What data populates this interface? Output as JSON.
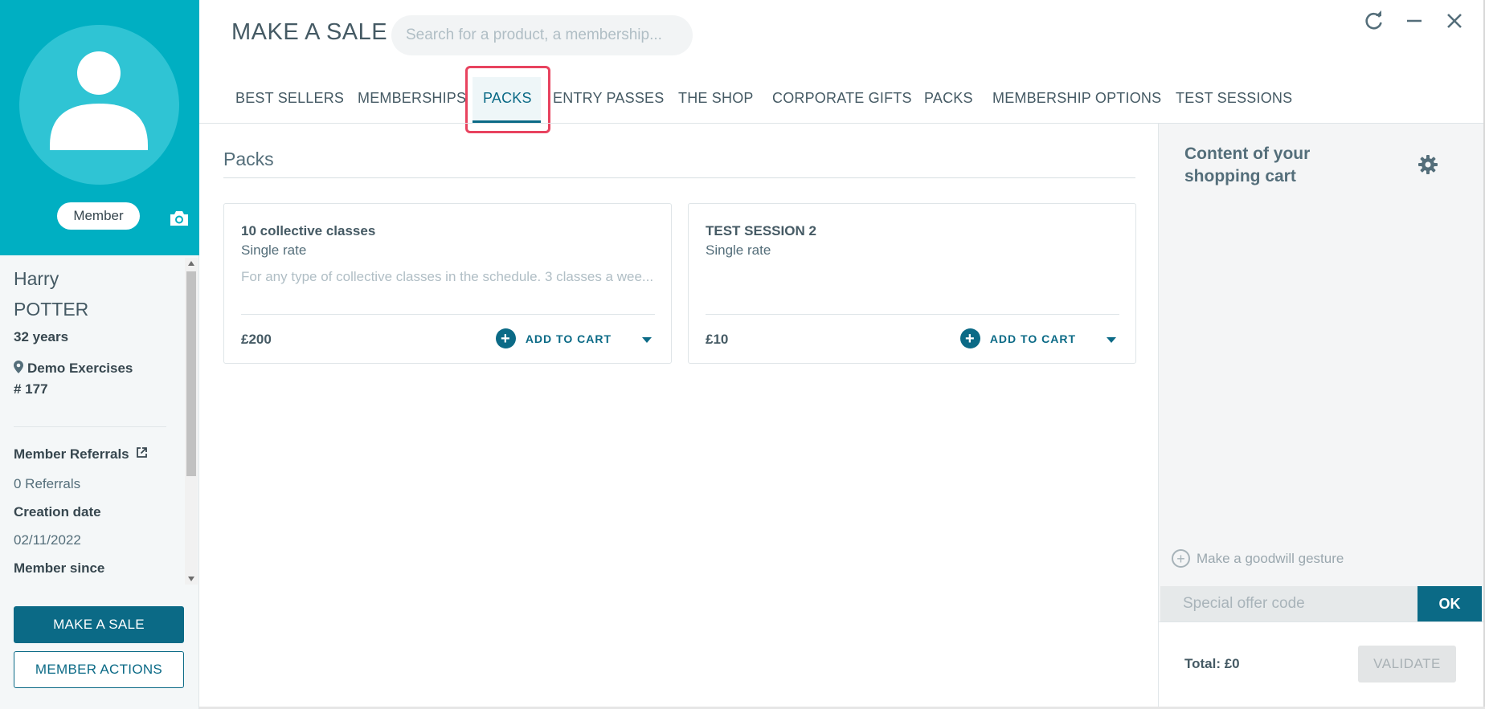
{
  "colors": {
    "brand_teal": "#00afc2",
    "primary": "#0b6a86",
    "highlight": "#e8435f",
    "text": "#455a64"
  },
  "member": {
    "badge": "Member",
    "first_name": "Harry",
    "last_name": "POTTER",
    "age": "32 years",
    "location": "Demo Exercises",
    "number": "# 177",
    "referrals_label": "Member Referrals",
    "referrals_value": "0 Referrals",
    "creation_label": "Creation date",
    "creation_value": "02/11/2022",
    "member_since_label": "Member since",
    "icons": {
      "avatar": "person-icon",
      "camera": "camera-icon",
      "location": "map-pin-icon",
      "external": "external-link-icon"
    }
  },
  "left_actions": {
    "make_sale": "MAKE A SALE",
    "member_actions": "MEMBER ACTIONS"
  },
  "header": {
    "title": "MAKE A SALE",
    "search_placeholder": "Search for a product, a membership...",
    "window_icons": [
      "refresh-icon",
      "minimize-icon",
      "close-icon"
    ]
  },
  "tabs": [
    {
      "label": "BEST SELLERS",
      "active": false
    },
    {
      "label": "MEMBERSHIPS",
      "active": false
    },
    {
      "label": "PACKS",
      "active": true
    },
    {
      "label": "ENTRY PASSES",
      "active": false
    },
    {
      "label": "THE SHOP",
      "active": false
    },
    {
      "label": "CORPORATE GIFTS",
      "active": false
    },
    {
      "label": "PACKS",
      "active": false
    },
    {
      "label": "MEMBERSHIP OPTIONS",
      "active": false
    },
    {
      "label": "TEST SESSIONS",
      "active": false
    }
  ],
  "main": {
    "section_title": "Packs",
    "products": [
      {
        "name": "10 collective classes",
        "rate": "Single rate",
        "description": "For any type of collective classes in the schedule. 3 classes a wee...",
        "price": "£200",
        "add_label": "ADD TO CART"
      },
      {
        "name": "TEST SESSION 2",
        "rate": "Single rate",
        "description": "",
        "price": "£10",
        "add_label": "ADD TO CART"
      }
    ]
  },
  "cart": {
    "title": "Content of your shopping cart",
    "gear_icon": "gear-icon",
    "goodwill": "Make a goodwill gesture",
    "offer_placeholder": "Special offer code",
    "ok": "OK",
    "total": "Total: £0",
    "validate": "VALIDATE"
  }
}
